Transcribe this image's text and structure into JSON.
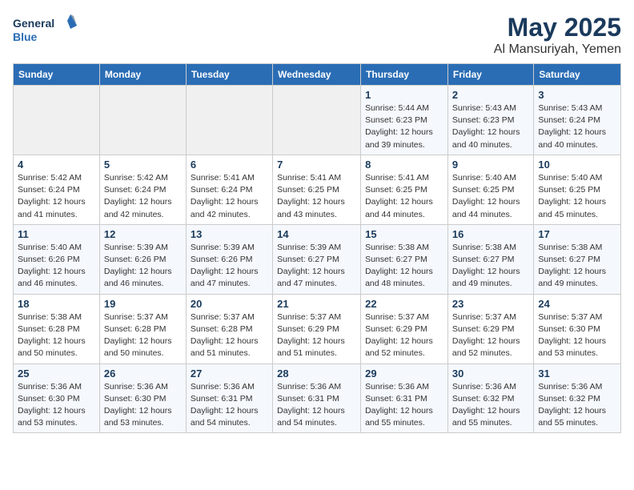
{
  "logo": {
    "line1": "General",
    "line2": "Blue"
  },
  "title": "May 2025",
  "location": "Al Mansuriyah, Yemen",
  "days_of_week": [
    "Sunday",
    "Monday",
    "Tuesday",
    "Wednesday",
    "Thursday",
    "Friday",
    "Saturday"
  ],
  "weeks": [
    [
      {
        "day": "",
        "info": ""
      },
      {
        "day": "",
        "info": ""
      },
      {
        "day": "",
        "info": ""
      },
      {
        "day": "",
        "info": ""
      },
      {
        "day": "1",
        "info": "Sunrise: 5:44 AM\nSunset: 6:23 PM\nDaylight: 12 hours\nand 39 minutes."
      },
      {
        "day": "2",
        "info": "Sunrise: 5:43 AM\nSunset: 6:23 PM\nDaylight: 12 hours\nand 40 minutes."
      },
      {
        "day": "3",
        "info": "Sunrise: 5:43 AM\nSunset: 6:24 PM\nDaylight: 12 hours\nand 40 minutes."
      }
    ],
    [
      {
        "day": "4",
        "info": "Sunrise: 5:42 AM\nSunset: 6:24 PM\nDaylight: 12 hours\nand 41 minutes."
      },
      {
        "day": "5",
        "info": "Sunrise: 5:42 AM\nSunset: 6:24 PM\nDaylight: 12 hours\nand 42 minutes."
      },
      {
        "day": "6",
        "info": "Sunrise: 5:41 AM\nSunset: 6:24 PM\nDaylight: 12 hours\nand 42 minutes."
      },
      {
        "day": "7",
        "info": "Sunrise: 5:41 AM\nSunset: 6:25 PM\nDaylight: 12 hours\nand 43 minutes."
      },
      {
        "day": "8",
        "info": "Sunrise: 5:41 AM\nSunset: 6:25 PM\nDaylight: 12 hours\nand 44 minutes."
      },
      {
        "day": "9",
        "info": "Sunrise: 5:40 AM\nSunset: 6:25 PM\nDaylight: 12 hours\nand 44 minutes."
      },
      {
        "day": "10",
        "info": "Sunrise: 5:40 AM\nSunset: 6:25 PM\nDaylight: 12 hours\nand 45 minutes."
      }
    ],
    [
      {
        "day": "11",
        "info": "Sunrise: 5:40 AM\nSunset: 6:26 PM\nDaylight: 12 hours\nand 46 minutes."
      },
      {
        "day": "12",
        "info": "Sunrise: 5:39 AM\nSunset: 6:26 PM\nDaylight: 12 hours\nand 46 minutes."
      },
      {
        "day": "13",
        "info": "Sunrise: 5:39 AM\nSunset: 6:26 PM\nDaylight: 12 hours\nand 47 minutes."
      },
      {
        "day": "14",
        "info": "Sunrise: 5:39 AM\nSunset: 6:27 PM\nDaylight: 12 hours\nand 47 minutes."
      },
      {
        "day": "15",
        "info": "Sunrise: 5:38 AM\nSunset: 6:27 PM\nDaylight: 12 hours\nand 48 minutes."
      },
      {
        "day": "16",
        "info": "Sunrise: 5:38 AM\nSunset: 6:27 PM\nDaylight: 12 hours\nand 49 minutes."
      },
      {
        "day": "17",
        "info": "Sunrise: 5:38 AM\nSunset: 6:27 PM\nDaylight: 12 hours\nand 49 minutes."
      }
    ],
    [
      {
        "day": "18",
        "info": "Sunrise: 5:38 AM\nSunset: 6:28 PM\nDaylight: 12 hours\nand 50 minutes."
      },
      {
        "day": "19",
        "info": "Sunrise: 5:37 AM\nSunset: 6:28 PM\nDaylight: 12 hours\nand 50 minutes."
      },
      {
        "day": "20",
        "info": "Sunrise: 5:37 AM\nSunset: 6:28 PM\nDaylight: 12 hours\nand 51 minutes."
      },
      {
        "day": "21",
        "info": "Sunrise: 5:37 AM\nSunset: 6:29 PM\nDaylight: 12 hours\nand 51 minutes."
      },
      {
        "day": "22",
        "info": "Sunrise: 5:37 AM\nSunset: 6:29 PM\nDaylight: 12 hours\nand 52 minutes."
      },
      {
        "day": "23",
        "info": "Sunrise: 5:37 AM\nSunset: 6:29 PM\nDaylight: 12 hours\nand 52 minutes."
      },
      {
        "day": "24",
        "info": "Sunrise: 5:37 AM\nSunset: 6:30 PM\nDaylight: 12 hours\nand 53 minutes."
      }
    ],
    [
      {
        "day": "25",
        "info": "Sunrise: 5:36 AM\nSunset: 6:30 PM\nDaylight: 12 hours\nand 53 minutes."
      },
      {
        "day": "26",
        "info": "Sunrise: 5:36 AM\nSunset: 6:30 PM\nDaylight: 12 hours\nand 53 minutes."
      },
      {
        "day": "27",
        "info": "Sunrise: 5:36 AM\nSunset: 6:31 PM\nDaylight: 12 hours\nand 54 minutes."
      },
      {
        "day": "28",
        "info": "Sunrise: 5:36 AM\nSunset: 6:31 PM\nDaylight: 12 hours\nand 54 minutes."
      },
      {
        "day": "29",
        "info": "Sunrise: 5:36 AM\nSunset: 6:31 PM\nDaylight: 12 hours\nand 55 minutes."
      },
      {
        "day": "30",
        "info": "Sunrise: 5:36 AM\nSunset: 6:32 PM\nDaylight: 12 hours\nand 55 minutes."
      },
      {
        "day": "31",
        "info": "Sunrise: 5:36 AM\nSunset: 6:32 PM\nDaylight: 12 hours\nand 55 minutes."
      }
    ]
  ]
}
